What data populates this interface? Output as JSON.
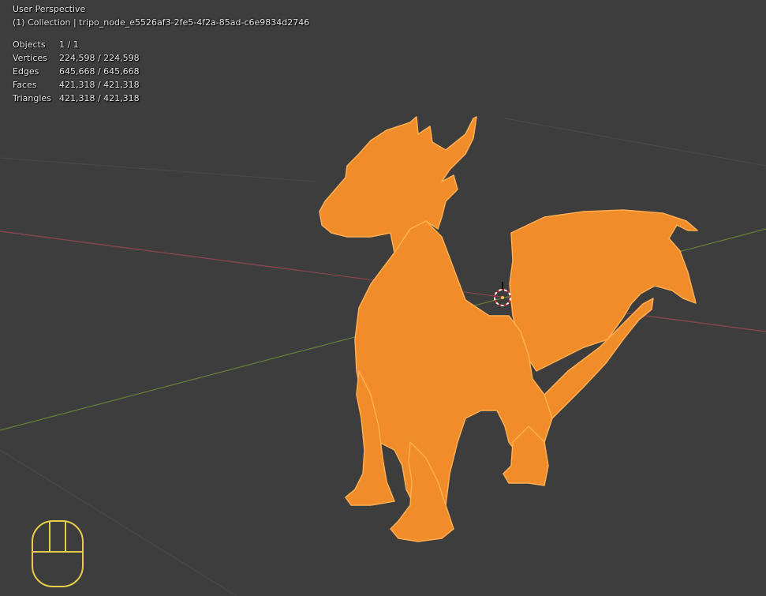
{
  "viewport": {
    "view_name": "User Perspective",
    "collection_line": "(1) Collection | tripo_node_e5526af3-2fe5-4f2a-85ad-c6e9834d2746"
  },
  "stats": [
    {
      "label": "Objects",
      "value": "1 / 1"
    },
    {
      "label": "Vertices",
      "value": "224,598 / 224,598"
    },
    {
      "label": "Edges",
      "value": "645,668 / 645,668"
    },
    {
      "label": "Faces",
      "value": "421,318 / 421,318"
    },
    {
      "label": "Triangles",
      "value": "421,318 / 421,318"
    }
  ],
  "icons": {
    "cursor": "3d-cursor-icon",
    "mouse": "mouse-icon"
  },
  "colors": {
    "background": "#3d3d3d",
    "x_axis": "#9a4a55",
    "y_axis": "#6a8a3a",
    "selected_mesh": "#f08c2a",
    "mouse_outline": "#e8cf4a"
  }
}
